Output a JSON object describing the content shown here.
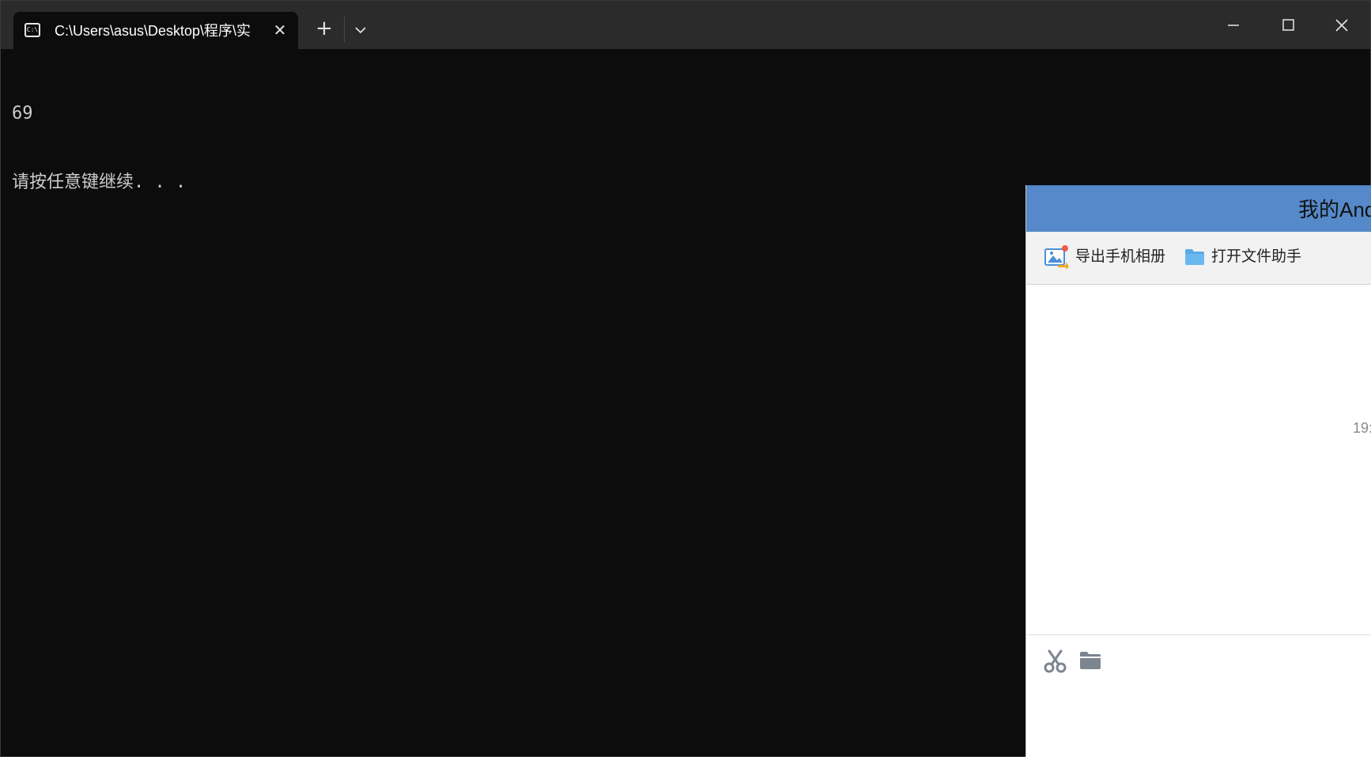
{
  "terminal": {
    "tab_title": "C:\\Users\\asus\\Desktop\\程序\\实",
    "tab_icon": "cmd-icon",
    "tab_icon_text": "C:\\",
    "close_tab_glyph": "✕",
    "new_tab_glyph": "+",
    "output_lines": [
      "69",
      "请按任意键继续. . ."
    ]
  },
  "chat_window": {
    "title": "我的Android",
    "toolbar": {
      "export_label": "导出手机相册",
      "open_label": "打开文件助手"
    },
    "timestamp": "19:",
    "input_tools": [
      "scissors-icon",
      "folder-icon"
    ],
    "colors": {
      "header": "#5589c9",
      "toolbar": "#f2f2f2"
    }
  },
  "colors": {
    "terminal_bg": "#0c0c0c",
    "titlebar_bg": "#2b2b2b",
    "text": "#cccccc"
  }
}
